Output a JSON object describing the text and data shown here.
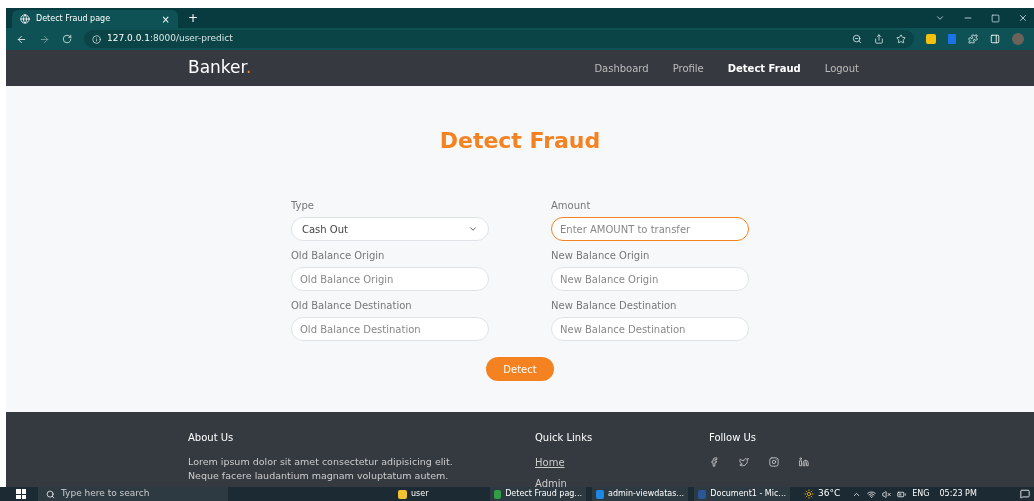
{
  "browser": {
    "tab": {
      "title": "Detect Fraud page",
      "close": "×"
    },
    "new_tab": "+",
    "url_host": "127.0.0.1",
    "url_path": ":8000/user-predict"
  },
  "navbar": {
    "brand": "Banker",
    "brand_dot": ".",
    "links": [
      {
        "label": "Dashboard",
        "selected": false
      },
      {
        "label": "Profile",
        "selected": false
      },
      {
        "label": "Detect Fraud",
        "selected": true
      },
      {
        "label": "Logout",
        "selected": false
      }
    ]
  },
  "heading": "Detect Fraud",
  "form": {
    "fields": [
      {
        "kind": "select",
        "label": "Type",
        "value": "Cash Out",
        "focused": false
      },
      {
        "kind": "input",
        "label": "Amount",
        "placeholder": "Enter AMOUNT to transfer",
        "focused": true
      },
      {
        "kind": "input",
        "label": "Old Balance Origin",
        "placeholder": "Old Balance Origin",
        "focused": false
      },
      {
        "kind": "input",
        "label": "New Balance Origin",
        "placeholder": "New Balance Origin",
        "focused": false
      },
      {
        "kind": "input",
        "label": "Old Balance Destination",
        "placeholder": "Old Balance Destination",
        "focused": false
      },
      {
        "kind": "input",
        "label": "New Balance Destination",
        "placeholder": "New Balance Destination",
        "focused": false
      }
    ],
    "submit": "Detect"
  },
  "footer": {
    "about": {
      "title": "About Us",
      "text": "Lorem ipsum dolor sit amet consectetur adipisicing elit. Neque facere laudantium magnam voluptatum autem."
    },
    "quick_links": {
      "title": "Quick Links",
      "links": [
        "Home",
        "Admin"
      ]
    },
    "follow": {
      "title": "Follow Us"
    }
  },
  "taskbar": {
    "search": "Type here to search",
    "apps": [
      {
        "label": "user",
        "kind": "folder"
      },
      {
        "label": "Detect Fraud pag...",
        "kind": "chrome"
      },
      {
        "label": "admin-viewdatas...",
        "kind": "vscode"
      },
      {
        "label": "Document1 - Mic...",
        "kind": "word"
      }
    ],
    "weather": "36°C",
    "lang": "ENG",
    "time": "05:23 PM"
  }
}
